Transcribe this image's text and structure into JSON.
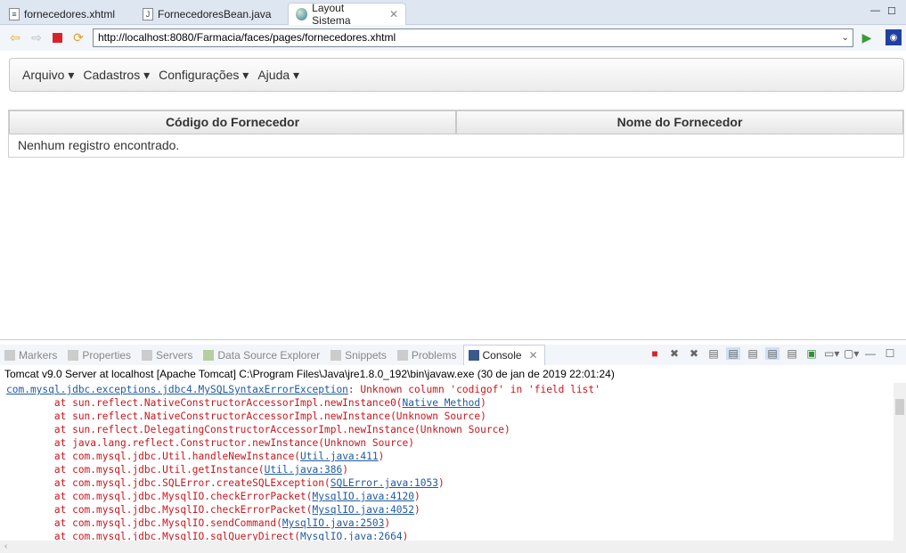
{
  "editor_tabs": [
    {
      "label": "fornecedores.xhtml",
      "icon": "file-icon"
    },
    {
      "label": "FornecedoresBean.java",
      "icon": "java-file-icon"
    },
    {
      "label": "Layout Sistema",
      "icon": "globe-icon"
    }
  ],
  "browser": {
    "url": "http://localhost:8080/Farmacia/faces/pages/fornecedores.xhtml"
  },
  "menu": [
    {
      "label": "Arquivo"
    },
    {
      "label": "Cadastros"
    },
    {
      "label": "Configurações"
    },
    {
      "label": "Ajuda"
    }
  ],
  "table": {
    "headers": [
      "Código do Fornecedor",
      "Nome do Fornecedor"
    ],
    "empty_message": "Nenhum registro encontrado."
  },
  "panel_tabs": [
    {
      "label": "Markers"
    },
    {
      "label": "Properties"
    },
    {
      "label": "Servers"
    },
    {
      "label": "Data Source Explorer"
    },
    {
      "label": "Snippets"
    },
    {
      "label": "Problems"
    },
    {
      "label": "Console"
    }
  ],
  "console": {
    "header": "Tomcat v9.0 Server at localhost [Apache Tomcat] C:\\Program Files\\Java\\jre1.8.0_192\\bin\\javaw.exe (30 de jan de 2019 22:01:24)",
    "lines": [
      {
        "pre": "",
        "link": "com.mysql.jdbc.exceptions.jdbc4.MySQLSyntaxErrorException",
        "post": ": Unknown column 'codigof' in 'field list'"
      },
      {
        "pre": "\tat sun.reflect.NativeConstructorAccessorImpl.newInstance0(",
        "link": "Native Method",
        "post": ")"
      },
      {
        "pre": "\tat sun.reflect.NativeConstructorAccessorImpl.newInstance(Unknown Source)",
        "link": "",
        "post": ""
      },
      {
        "pre": "\tat sun.reflect.DelegatingConstructorAccessorImpl.newInstance(Unknown Source)",
        "link": "",
        "post": ""
      },
      {
        "pre": "\tat java.lang.reflect.Constructor.newInstance(Unknown Source)",
        "link": "",
        "post": ""
      },
      {
        "pre": "\tat com.mysql.jdbc.Util.handleNewInstance(",
        "link": "Util.java:411",
        "post": ")"
      },
      {
        "pre": "\tat com.mysql.jdbc.Util.getInstance(",
        "link": "Util.java:386",
        "post": ")"
      },
      {
        "pre": "\tat com.mysql.jdbc.SQLError.createSQLException(",
        "link": "SQLError.java:1053",
        "post": ")"
      },
      {
        "pre": "\tat com.mysql.jdbc.MysqlIO.checkErrorPacket(",
        "link": "MysqlIO.java:4120",
        "post": ")"
      },
      {
        "pre": "\tat com.mysql.jdbc.MysqlIO.checkErrorPacket(",
        "link": "MysqlIO.java:4052",
        "post": ")"
      },
      {
        "pre": "\tat com.mysql.jdbc.MysqlIO.sendCommand(",
        "link": "MysqlIO.java:2503",
        "post": ")"
      },
      {
        "pre": "\tat com.mysql.jdbc.MysqlIO.sqlQueryDirect(",
        "link": "MysqlIO.java:2664",
        "post": ")"
      }
    ]
  }
}
